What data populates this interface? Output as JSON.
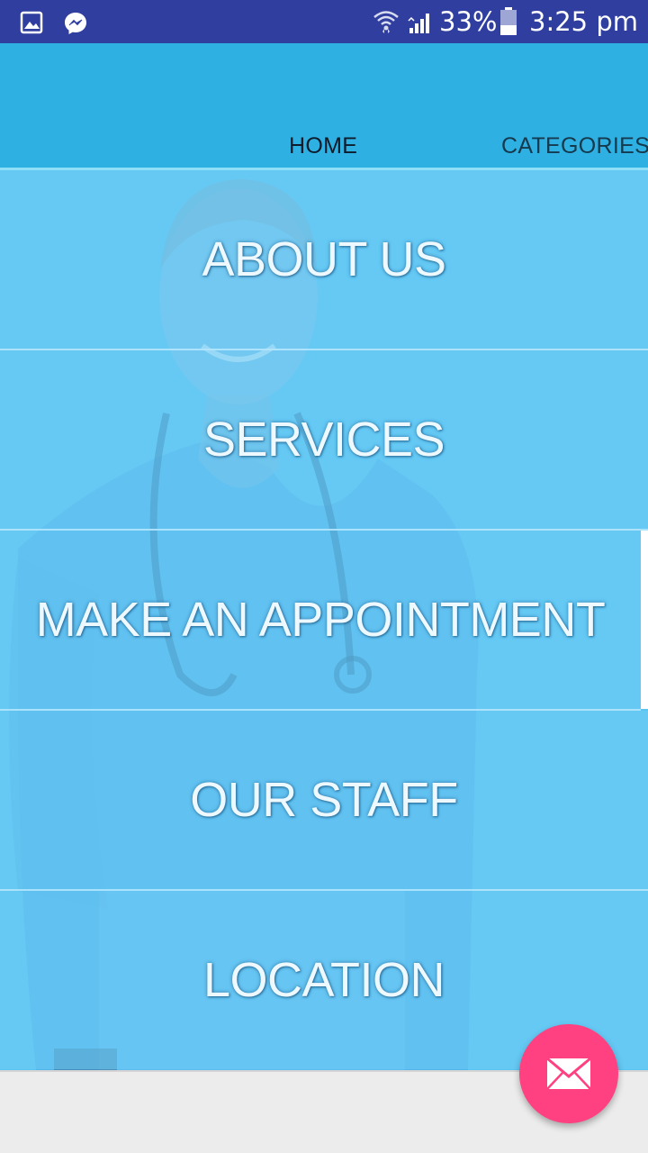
{
  "status_bar": {
    "left_icons": [
      "gallery-icon",
      "messenger-icon"
    ],
    "right_icons": [
      "wifi-icon",
      "signal-icon",
      "battery-icon"
    ],
    "battery_percent": "33%",
    "time": "3:25 pm"
  },
  "tabs": [
    {
      "label": "HOME",
      "selected": true
    },
    {
      "label": "CATEGORIES",
      "selected": false
    }
  ],
  "menu": {
    "items": [
      {
        "label": "ABOUT US"
      },
      {
        "label": "SERVICES"
      },
      {
        "label": "MAKE AN APPOINTMENT"
      },
      {
        "label": "OUR STAFF"
      },
      {
        "label": "LOCATION"
      }
    ],
    "background_icon": "doctor-illustration"
  },
  "fab": {
    "icon": "mail-icon"
  },
  "colors": {
    "status_bar": "#303f9f",
    "app_bar": "#2fb0e3",
    "menu_overlay": "#5cc4f1",
    "fab": "#ff4081"
  }
}
